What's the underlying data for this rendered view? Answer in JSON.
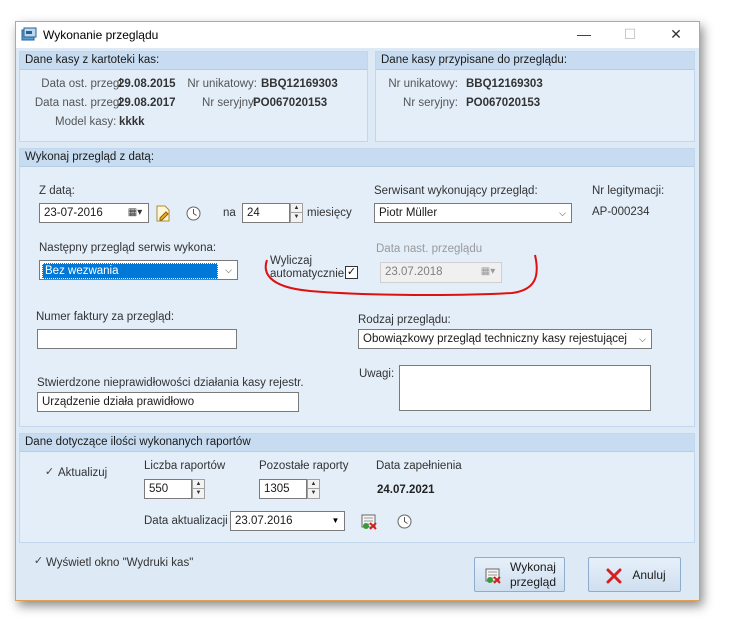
{
  "window": {
    "title": "Wykonanie przeglądu",
    "minimize": "—",
    "maximize": "☐",
    "close": "✕"
  },
  "kasa_kartoteka": {
    "header": "Dane kasy z kartoteki kas:",
    "data_ost_label": "Data ost. przegl.",
    "data_ost_value": "29.08.2015",
    "nr_unik_label": "Nr unikatowy:",
    "nr_unik_value": "BBQ12169303",
    "data_nast_label": "Data nast. przegl.",
    "data_nast_value": "29.08.2017",
    "nr_ser_label": "Nr seryjny:",
    "nr_ser_value": "PO067020153",
    "model_label": "Model kasy:",
    "model_value": "kkkk"
  },
  "kasa_przeglad": {
    "header": "Dane kasy przypisane do przeglądu:",
    "nr_unik_label": "Nr unikatowy:",
    "nr_unik_value": "BBQ12169303",
    "nr_ser_label": "Nr seryjny:",
    "nr_ser_value": "PO067020153"
  },
  "przeglad": {
    "header": "Wykonaj przegląd z datą:",
    "z_daty_label": "Z datą:",
    "z_daty_value": "23-07-2016",
    "na_label": "na",
    "miesiecy_value": "24",
    "miesiecy_label": "miesięcy",
    "serwisant_label": "Serwisant wykonujący przegląd:",
    "serwisant_value": "Piotr Müller",
    "legit_label": "Nr legitymacji:",
    "legit_value": "AP-000234",
    "nastepny_label": "Następny przegląd serwis wykona:",
    "nastepny_value": "Bez wezwania",
    "wyliczaj_line1": "Wyliczaj",
    "wyliczaj_line2": "automatycznie",
    "wyliczaj_checked": "✓",
    "data_nast_label": "Data nast. przeglądu",
    "data_nast_value": "23.07.2018",
    "faktura_label": "Numer faktury za przegląd:",
    "faktura_value": "",
    "rodzaj_label": "Rodzaj przeglądu:",
    "rodzaj_value": "Obowiązkowy przegląd techniczny kasy rejestującej",
    "stwierdzone_label": "Stwierdzone nieprawidłowości działania kasy rejestr.",
    "stwierdzone_value": "Urządzenie działa prawidłowo",
    "uwagi_label": "Uwagi:",
    "uwagi_value": ""
  },
  "raporty": {
    "header": "Dane dotyczące ilości wykonanych raportów",
    "aktualizuj_label": "Aktualizuj",
    "aktualizuj_checked": "✓",
    "liczba_label": "Liczba raportów",
    "liczba_value": "550",
    "pozostale_label": "Pozostałe raporty",
    "pozostale_value": "1305",
    "zapelnienie_label": "Data zapełnienia",
    "zapelnienie_value": "24.07.2021",
    "data_akt_label": "Data aktualizacji",
    "data_akt_value": "23.07.2016"
  },
  "footer": {
    "wydruki_label": "Wyświetl okno \"Wydruki kas\"",
    "wydruki_checked": "✓",
    "wykonaj_line1": "Wykonaj",
    "wykonaj_line2": "przegląd",
    "anuluj_label": "Anuluj"
  },
  "colors": {
    "annotation": "#e01010",
    "accent": "#0078d7",
    "header_bg": "#c7dcf1"
  }
}
